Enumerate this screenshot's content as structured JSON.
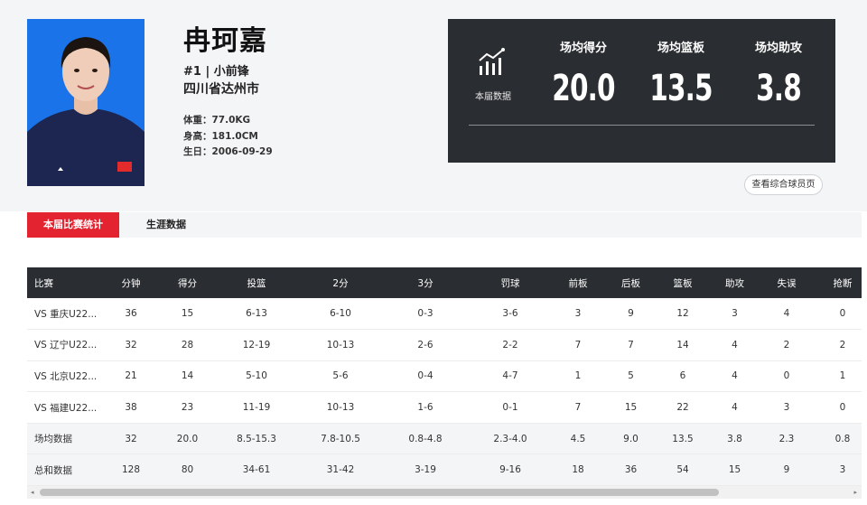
{
  "player": {
    "name": "冉珂嘉",
    "number_position": "#1 | 小前锋",
    "city": "四川省达州市",
    "weight": "体重：77.0KG",
    "height": "身高：181.0CM",
    "birth": "生日：2006-09-29"
  },
  "season_stats": {
    "label": "本届数据",
    "icon": "bar-chart-trend-icon",
    "items": [
      {
        "title": "场均得分",
        "value": "20.0"
      },
      {
        "title": "场均篮板",
        "value": "13.5"
      },
      {
        "title": "场均助攻",
        "value": "3.8"
      }
    ]
  },
  "profile_button": "查看综合球员页",
  "tabs": [
    {
      "label": "本届比赛统计",
      "active": true
    },
    {
      "label": "生涯数据",
      "active": false
    }
  ],
  "colors": {
    "accent": "#e3232f",
    "dark_panel": "#2a2d31",
    "bg": "#f4f5f7"
  },
  "table": {
    "headers": [
      "比赛",
      "分钟",
      "得分",
      "投篮",
      "2分",
      "3分",
      "罚球",
      "前板",
      "后板",
      "篮板",
      "助攻",
      "失误",
      "抢断"
    ],
    "games": [
      [
        "VS 重庆U22...",
        "36",
        "15",
        "6-13",
        "6-10",
        "0-3",
        "3-6",
        "3",
        "9",
        "12",
        "3",
        "4",
        "0"
      ],
      [
        "VS 辽宁U22...",
        "32",
        "28",
        "12-19",
        "10-13",
        "2-6",
        "2-2",
        "7",
        "7",
        "14",
        "4",
        "2",
        "2"
      ],
      [
        "VS 北京U22...",
        "21",
        "14",
        "5-10",
        "5-6",
        "0-4",
        "4-7",
        "1",
        "5",
        "6",
        "4",
        "0",
        "1"
      ],
      [
        "VS 福建U22...",
        "38",
        "23",
        "11-19",
        "10-13",
        "1-6",
        "0-1",
        "7",
        "15",
        "22",
        "4",
        "3",
        "0"
      ]
    ],
    "summary": [
      [
        "场均数据",
        "32",
        "20.0",
        "8.5-15.3",
        "7.8-10.5",
        "0.8-4.8",
        "2.3-4.0",
        "4.5",
        "9.0",
        "13.5",
        "3.8",
        "2.3",
        "0.8"
      ],
      [
        "总和数据",
        "128",
        "80",
        "34-61",
        "31-42",
        "3-19",
        "9-16",
        "18",
        "36",
        "54",
        "15",
        "9",
        "3"
      ]
    ]
  },
  "scrollbar": {
    "left_arrow": "◂",
    "right_arrow": "▸"
  }
}
